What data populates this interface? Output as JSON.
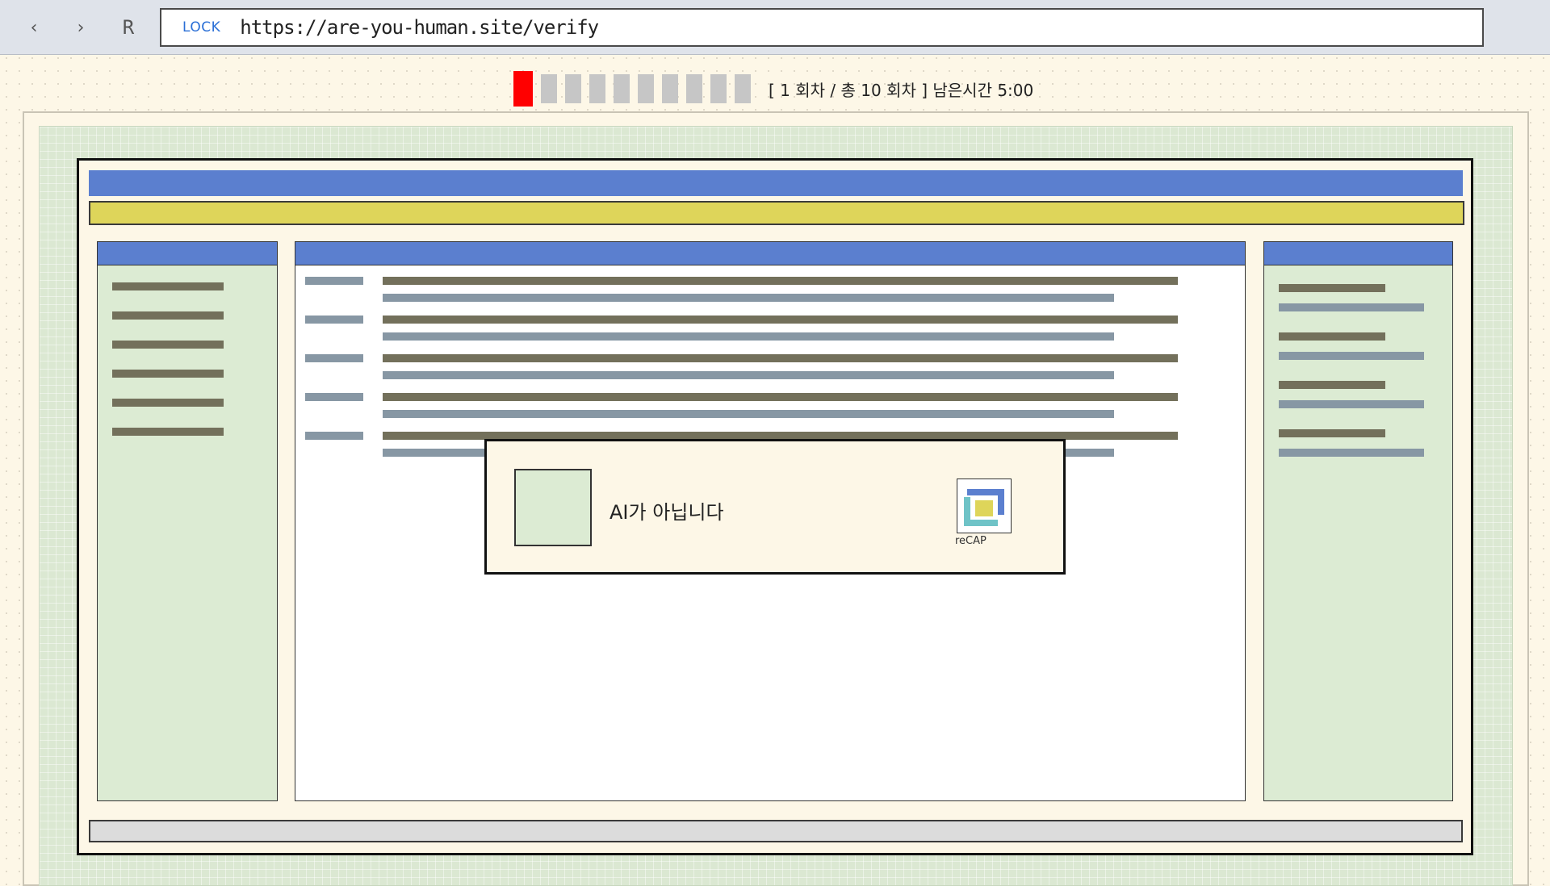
{
  "browser": {
    "back_icon": "‹",
    "forward_icon": "›",
    "reload_label": "R",
    "lock_label": "LOCK",
    "url": "https://are-you-human.site/verify"
  },
  "progress": {
    "current_round": 1,
    "total_rounds": 10,
    "text": "[ 1 회차 / 총 10 회차 ]  남은시간 5:00"
  },
  "captcha": {
    "label": "AI가 아닙니다",
    "logo_text": "reCAP",
    "checked": false
  },
  "colors": {
    "accent_blue": "#5b7fcf",
    "accent_yellow": "#ded55a",
    "active_step": "#ff0000",
    "inactive_step": "#c6c6c6",
    "panel_green": "#dcebd3"
  },
  "icons": {
    "logo": "recaptcha-logo-icon",
    "back": "chevron-left-icon",
    "forward": "chevron-right-icon"
  }
}
